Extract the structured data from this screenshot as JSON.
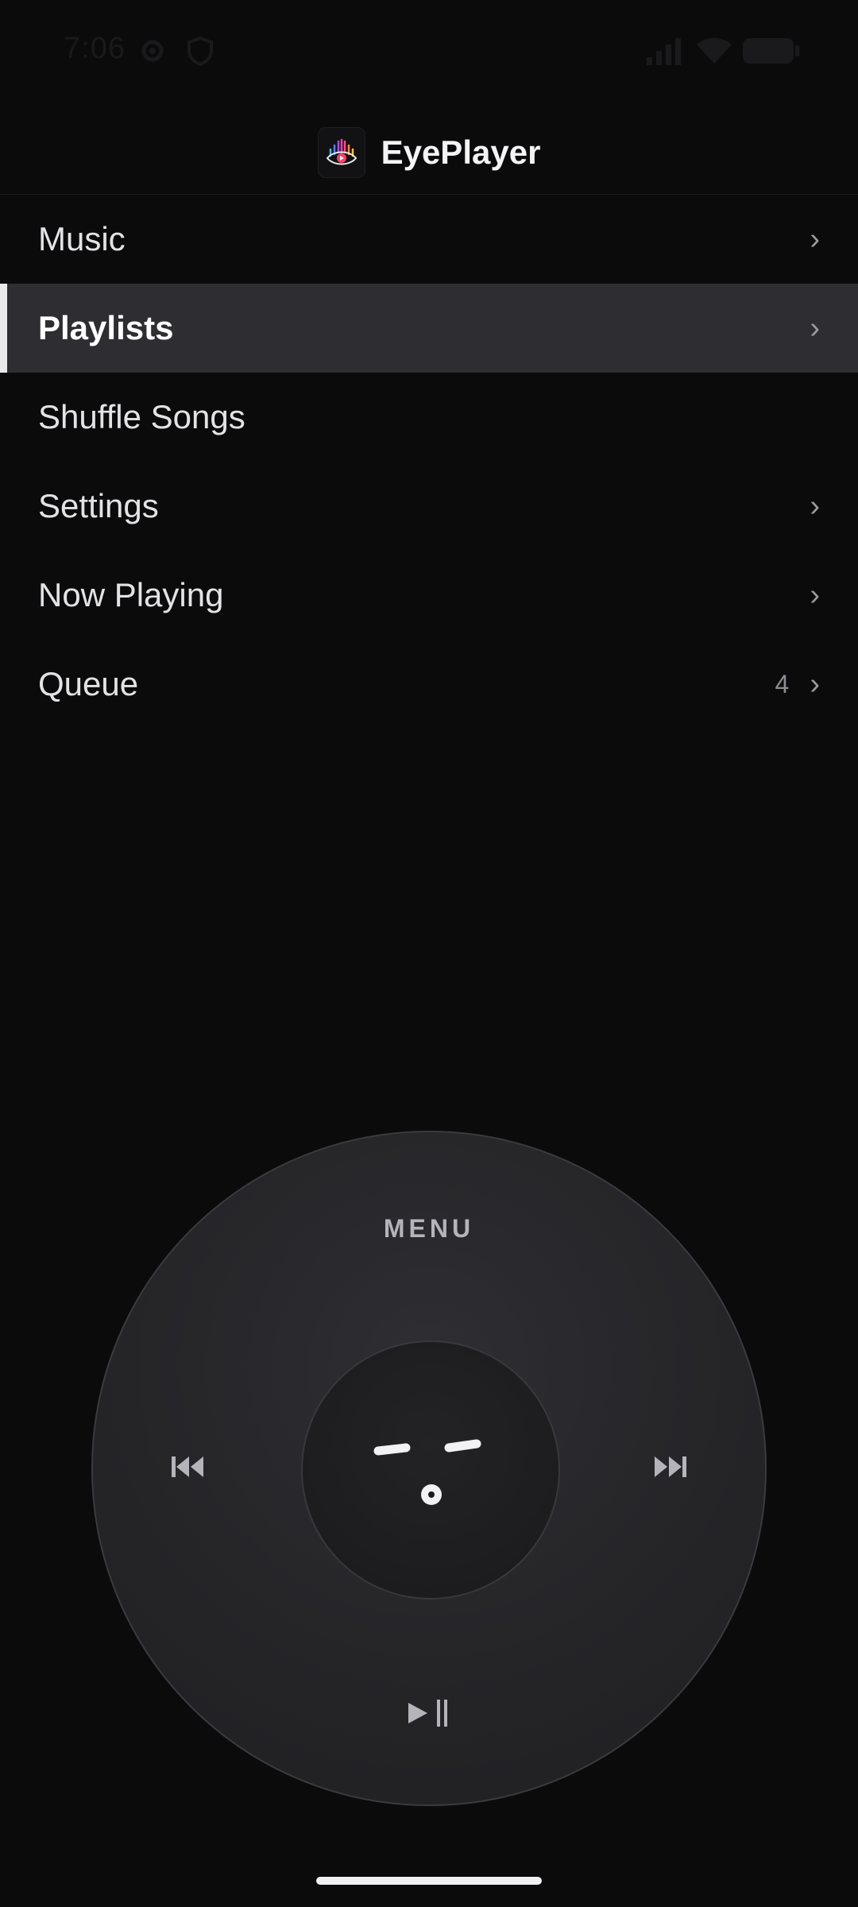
{
  "status_bar": {
    "time": "7:06",
    "icons": [
      "settings-gear-icon",
      "shield-icon",
      "signal-icon",
      "wifi-icon",
      "battery-icon"
    ]
  },
  "header": {
    "title": "EyePlayer",
    "logo_icon": "eye-play-logo"
  },
  "menu": {
    "items": [
      {
        "label": "Music",
        "count": "",
        "chevron": "›"
      },
      {
        "label": "Playlists",
        "count": "",
        "chevron": "›",
        "selected": true
      },
      {
        "label": "Shuffle Songs",
        "count": "",
        "chevron": ""
      },
      {
        "label": "Settings",
        "count": "",
        "chevron": "›"
      },
      {
        "label": "Now Playing",
        "count": "",
        "chevron": "›"
      },
      {
        "label": "Queue",
        "count": "4",
        "chevron": "›"
      }
    ]
  },
  "wheel": {
    "menu_label": "MENU",
    "prev_icon": "previous-track-icon",
    "next_icon": "next-track-icon",
    "play_pause_icon": "play-pause-icon",
    "center_icon": "face-icon"
  },
  "colors": {
    "background": "#0b0b0c",
    "selected_row": "#2d2d32",
    "accent_bar": "#e9e9ec",
    "wheel": "#27272b",
    "wheel_icons": "#b4b4ba"
  }
}
